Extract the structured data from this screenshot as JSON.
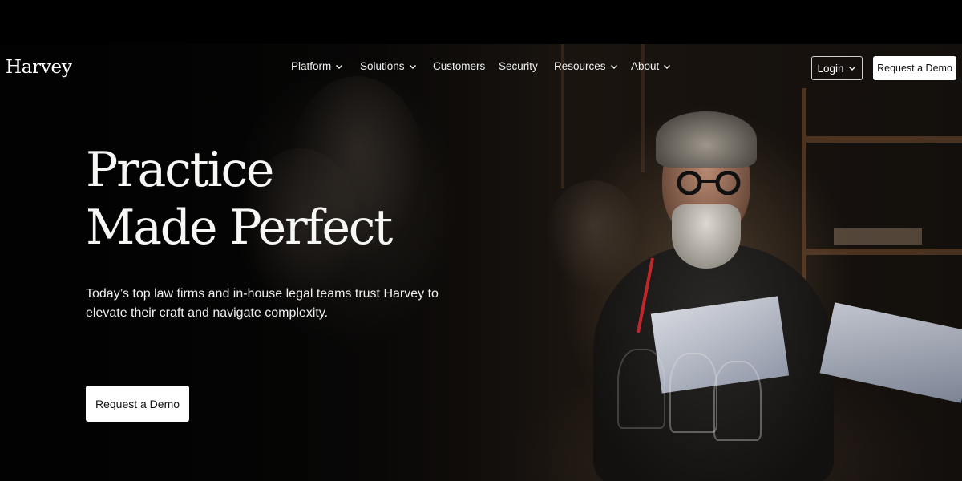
{
  "brand": {
    "name": "Harvey"
  },
  "nav": {
    "items": [
      {
        "label": "Platform",
        "has_dropdown": true
      },
      {
        "label": "Solutions",
        "has_dropdown": true
      },
      {
        "label": "Customers",
        "has_dropdown": false
      },
      {
        "label": "Security",
        "has_dropdown": false
      },
      {
        "label": "Resources",
        "has_dropdown": true
      },
      {
        "label": "About",
        "has_dropdown": true
      }
    ],
    "login_label": "Login",
    "demo_label": "Request a Demo"
  },
  "hero": {
    "headline_line1": "Practice",
    "headline_line2": "Made Perfect",
    "subtext": "Today’s top law firms and in-house legal teams trust Harvey to elevate their craft and navigate complexity.",
    "cta_label": "Request a Demo"
  },
  "colors": {
    "background": "#000000",
    "text": "#ffffff",
    "button_bg": "#ffffff",
    "button_text": "#111111"
  }
}
